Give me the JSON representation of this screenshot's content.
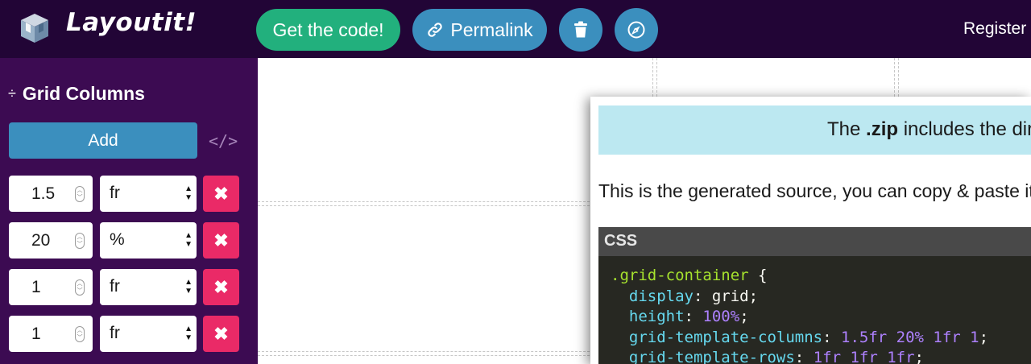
{
  "header": {
    "brand": "Layoutit!",
    "get_code_label": "Get the code!",
    "permalink_label": "Permalink",
    "register_label": "Register",
    "icons": [
      "cube-logo-icon",
      "link-icon",
      "trash-icon",
      "compass-icon"
    ]
  },
  "sidebar": {
    "section_icon": "÷",
    "section_title": "Grid Columns",
    "add_label": "Add",
    "code_toggle": "</>",
    "rows": [
      {
        "value": "1.5",
        "unit": "fr"
      },
      {
        "value": "20",
        "unit": "%"
      },
      {
        "value": "1",
        "unit": "fr"
      },
      {
        "value": "1",
        "unit": "fr"
      }
    ],
    "delete_glyph": "✖"
  },
  "modal": {
    "info_prefix": "The ",
    "info_bold": ".zip",
    "info_suffix": " includes the dire",
    "description": "This is the generated source, you can copy & paste it",
    "code_lang": "CSS",
    "code": {
      "selector": ".grid-container",
      "open_brace": " {",
      "lines": [
        {
          "prop": "display",
          "value": "grid",
          "value_type": "text"
        },
        {
          "prop": "height",
          "value": "100%",
          "value_type": "num"
        },
        {
          "prop": "grid-template-columns",
          "value": "1.5fr 20% 1fr 1",
          "value_type": "num"
        },
        {
          "prop": "grid-template-rows",
          "value": "1fr 1fr 1fr",
          "value_type": "num"
        }
      ]
    }
  },
  "colors": {
    "header_bg": "#220536",
    "sidebar_bg": "#3c0b52",
    "green": "#22b07d",
    "blue": "#3b8fbe",
    "pink": "#ea2a67",
    "info_bg": "#bce8f1",
    "code_bg": "#272822"
  }
}
